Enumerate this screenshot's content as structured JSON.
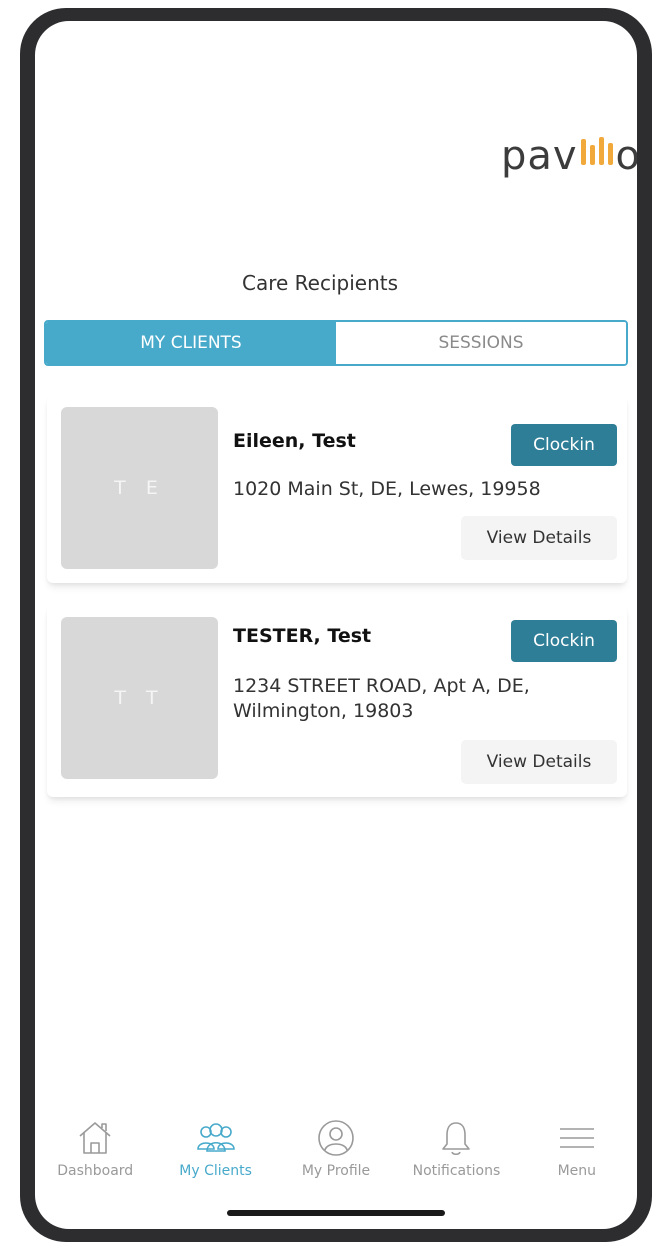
{
  "brand": {
    "logo_text_left": "pav",
    "logo_text_right": "o",
    "accent": "#48aacb"
  },
  "page": {
    "title": "Care Recipients"
  },
  "tabs": [
    {
      "label": "MY CLIENTS",
      "active": true
    },
    {
      "label": "SESSIONS",
      "active": false
    }
  ],
  "clients": [
    {
      "initials": "T E",
      "name": "Eileen, Test",
      "address": "1020 Main St, DE, Lewes, 19958",
      "clockin_label": "Clockin",
      "details_label": "View Details"
    },
    {
      "initials": "T T",
      "name": "TESTER, Test",
      "address": "1234 STREET ROAD, Apt A, DE, Wilmington, 19803",
      "clockin_label": "Clockin",
      "details_label": "View Details"
    }
  ],
  "nav": [
    {
      "label": "Dashboard",
      "icon": "home-icon",
      "active": false
    },
    {
      "label": "My Clients",
      "icon": "clients-icon",
      "active": true
    },
    {
      "label": "My Profile",
      "icon": "profile-icon",
      "active": false
    },
    {
      "label": "Notifications",
      "icon": "bell-icon",
      "active": false
    },
    {
      "label": "Menu",
      "icon": "hamburger-icon",
      "active": false
    }
  ],
  "colors": {
    "tab_active": "#48aacb",
    "clockin_button": "#2f7e97",
    "logo_bars": "#f2a93b",
    "nav_active": "#48aacb",
    "nav_inactive": "#9a9a9a"
  }
}
